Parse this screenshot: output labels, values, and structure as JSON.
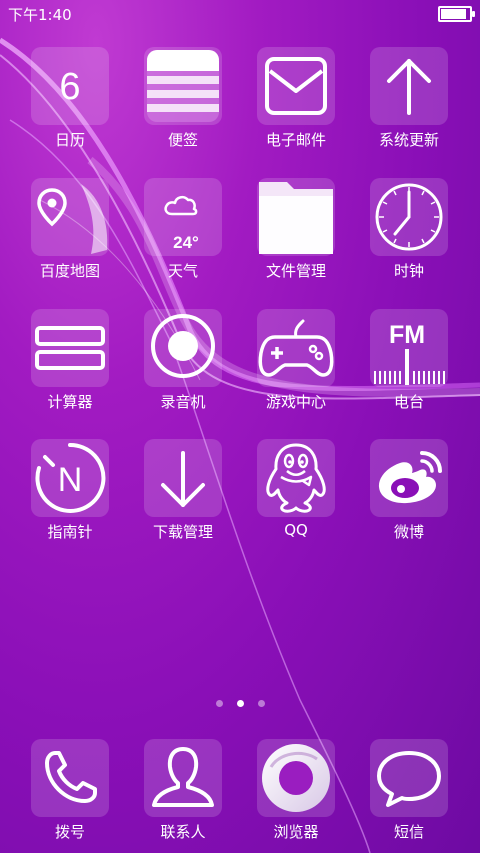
{
  "status_bar": {
    "time": "下午1:40",
    "battery_level": 0.95
  },
  "apps": [
    {
      "label": "日历",
      "icon": "calendar-icon",
      "text": "6"
    },
    {
      "label": "便签",
      "icon": "notes-icon"
    },
    {
      "label": "电子邮件",
      "icon": "mail-icon"
    },
    {
      "label": "系统更新",
      "icon": "update-arrow-icon"
    },
    {
      "label": "百度地图",
      "icon": "map-icon"
    },
    {
      "label": "天气",
      "icon": "weather-cloud-icon",
      "text": "24°"
    },
    {
      "label": "文件管理",
      "icon": "folder-icon"
    },
    {
      "label": "时钟",
      "icon": "clock-icon"
    },
    {
      "label": "计算器",
      "icon": "calculator-icon"
    },
    {
      "label": "录音机",
      "icon": "recorder-icon"
    },
    {
      "label": "游戏中心",
      "icon": "gamepad-icon"
    },
    {
      "label": "电台",
      "icon": "radio-icon",
      "text": "FM"
    },
    {
      "label": "指南针",
      "icon": "compass-icon",
      "text": "N"
    },
    {
      "label": "下载管理",
      "icon": "download-icon"
    },
    {
      "label": "QQ",
      "icon": "qq-penguin-icon"
    },
    {
      "label": "微博",
      "icon": "weibo-icon"
    }
  ],
  "page_indicator": {
    "count": 3,
    "active": 2
  },
  "dock": [
    {
      "label": "拨号",
      "icon": "phone-icon"
    },
    {
      "label": "联系人",
      "icon": "contacts-icon"
    },
    {
      "label": "浏览器",
      "icon": "browser-icon"
    },
    {
      "label": "短信",
      "icon": "messages-icon"
    }
  ]
}
